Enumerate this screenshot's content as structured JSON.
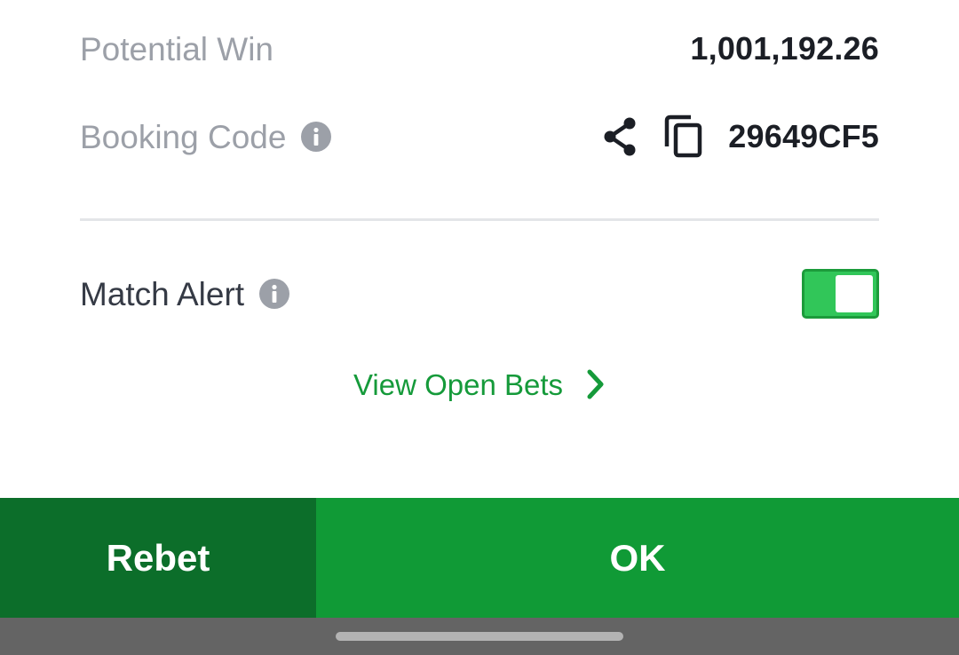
{
  "summary": {
    "potential_win": {
      "label": "Potential Win",
      "value": "1,001,192.26"
    },
    "booking_code": {
      "label": "Booking Code",
      "info_icon": "info-icon",
      "share_icon": "share-icon",
      "copy_icon": "copy-icon",
      "value": "29649CF5"
    }
  },
  "match_alert": {
    "label": "Match Alert",
    "info_icon": "info-icon",
    "toggle_on": true
  },
  "view_open_bets": {
    "label": "View Open Bets",
    "icon": "chevron-right-icon"
  },
  "actions": {
    "rebet_label": "Rebet",
    "ok_label": "OK"
  },
  "colors": {
    "brand_green": "#109a36",
    "dark_green": "#0c6e2a",
    "toggle_green": "#31c659",
    "link_green": "#159a3a",
    "muted_text": "#9ca0a8"
  }
}
